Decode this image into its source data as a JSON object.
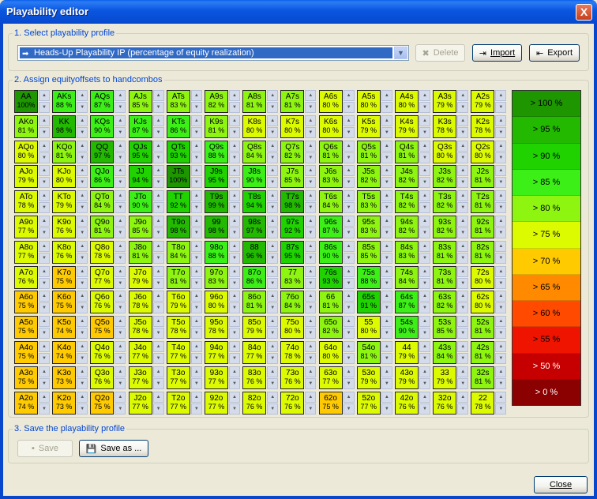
{
  "window": {
    "title": "Playability editor",
    "close_glyph": "X"
  },
  "section1": {
    "label": "1. Select playability profile",
    "profile_value": "Heads-Up Playability IP  (percentage of equity realization)",
    "delete_label": "Delete",
    "import_label": "Import",
    "export_label": "Export"
  },
  "section2": {
    "label": "2. Assign equityoffsets to handcombos"
  },
  "grid": [
    [
      [
        "AA",
        "100%"
      ],
      [
        "AKs",
        "88 %"
      ],
      [
        "AQs",
        "87 %"
      ],
      [
        "AJs",
        "85 %"
      ],
      [
        "ATs",
        "83 %"
      ],
      [
        "A9s",
        "82 %"
      ],
      [
        "A8s",
        "81 %"
      ],
      [
        "A7s",
        "81 %"
      ],
      [
        "A6s",
        "80 %"
      ],
      [
        "A5s",
        "80 %"
      ],
      [
        "A4s",
        "80 %"
      ],
      [
        "A3s",
        "79 %"
      ],
      [
        "A2s",
        "79 %"
      ]
    ],
    [
      [
        "AKo",
        "81 %"
      ],
      [
        "KK",
        "98 %"
      ],
      [
        "KQs",
        "90 %"
      ],
      [
        "KJs",
        "87 %"
      ],
      [
        "KTs",
        "86 %"
      ],
      [
        "K9s",
        "81 %"
      ],
      [
        "K8s",
        "80 %"
      ],
      [
        "K7s",
        "80 %"
      ],
      [
        "K6s",
        "80 %"
      ],
      [
        "K5s",
        "79 %"
      ],
      [
        "K4s",
        "79 %"
      ],
      [
        "K3s",
        "78 %"
      ],
      [
        "K2s",
        "78 %"
      ]
    ],
    [
      [
        "AQo",
        "80 %"
      ],
      [
        "KQo",
        "81 %"
      ],
      [
        "QQ",
        "97 %"
      ],
      [
        "QJs",
        "95 %"
      ],
      [
        "QTs",
        "93 %"
      ],
      [
        "Q9s",
        "88 %"
      ],
      [
        "Q8s",
        "84 %"
      ],
      [
        "Q7s",
        "82 %"
      ],
      [
        "Q6s",
        "81 %"
      ],
      [
        "Q5s",
        "81 %"
      ],
      [
        "Q4s",
        "81 %"
      ],
      [
        "Q3s",
        "80 %"
      ],
      [
        "Q2s",
        "80 %"
      ]
    ],
    [
      [
        "AJo",
        "79 %"
      ],
      [
        "KJo",
        "80 %"
      ],
      [
        "QJo",
        "86 %"
      ],
      [
        "JJ",
        "94 %"
      ],
      [
        "JTs",
        "100%"
      ],
      [
        "J9s",
        "95 %"
      ],
      [
        "J8s",
        "90 %"
      ],
      [
        "J7s",
        "85 %"
      ],
      [
        "J6s",
        "83 %"
      ],
      [
        "J5s",
        "82 %"
      ],
      [
        "J4s",
        "82 %"
      ],
      [
        "J3s",
        "82 %"
      ],
      [
        "J2s",
        "81 %"
      ]
    ],
    [
      [
        "ATo",
        "78 %"
      ],
      [
        "KTo",
        "79 %"
      ],
      [
        "QTo",
        "84 %"
      ],
      [
        "JTo",
        "90 %"
      ],
      [
        "TT",
        "92 %"
      ],
      [
        "T9s",
        "99 %"
      ],
      [
        "T8s",
        "94 %"
      ],
      [
        "T7s",
        "98 %"
      ],
      [
        "T6s",
        "84 %"
      ],
      [
        "T5s",
        "83 %"
      ],
      [
        "T4s",
        "82 %"
      ],
      [
        "T3s",
        "82 %"
      ],
      [
        "T2s",
        "81 %"
      ]
    ],
    [
      [
        "A9o",
        "77 %"
      ],
      [
        "K9o",
        "76 %"
      ],
      [
        "Q9o",
        "81 %"
      ],
      [
        "J9o",
        "85 %"
      ],
      [
        "T9o",
        "98 %"
      ],
      [
        "99",
        "98 %"
      ],
      [
        "98s",
        "97 %"
      ],
      [
        "97s",
        "92 %"
      ],
      [
        "96s",
        "87 %"
      ],
      [
        "95s",
        "83 %"
      ],
      [
        "94s",
        "82 %"
      ],
      [
        "93s",
        "82 %"
      ],
      [
        "92s",
        "81 %"
      ]
    ],
    [
      [
        "A8o",
        "77 %"
      ],
      [
        "K8o",
        "76 %"
      ],
      [
        "Q8o",
        "78 %"
      ],
      [
        "J8o",
        "81 %"
      ],
      [
        "T8o",
        "84 %"
      ],
      [
        "98o",
        "88 %"
      ],
      [
        "88",
        "96 %"
      ],
      [
        "87s",
        "95 %"
      ],
      [
        "86s",
        "90 %"
      ],
      [
        "85s",
        "85 %"
      ],
      [
        "84s",
        "83 %"
      ],
      [
        "83s",
        "81 %"
      ],
      [
        "82s",
        "81 %"
      ]
    ],
    [
      [
        "A7o",
        "76 %"
      ],
      [
        "K7o",
        "75 %"
      ],
      [
        "Q7o",
        "77 %"
      ],
      [
        "J7o",
        "79 %"
      ],
      [
        "T7o",
        "81 %"
      ],
      [
        "97o",
        "83 %"
      ],
      [
        "87o",
        "86 %"
      ],
      [
        "77",
        "83 %"
      ],
      [
        "76s",
        "93 %"
      ],
      [
        "75s",
        "88 %"
      ],
      [
        "74s",
        "84 %"
      ],
      [
        "73s",
        "81 %"
      ],
      [
        "72s",
        "80 %"
      ]
    ],
    [
      [
        "A6o",
        "75 %"
      ],
      [
        "K6o",
        "75 %"
      ],
      [
        "Q6o",
        "76 %"
      ],
      [
        "J6o",
        "78 %"
      ],
      [
        "T6o",
        "79 %"
      ],
      [
        "96o",
        "80 %"
      ],
      [
        "86o",
        "81 %"
      ],
      [
        "76o",
        "84 %"
      ],
      [
        "66",
        "81 %"
      ],
      [
        "65s",
        "91 %"
      ],
      [
        "64s",
        "87 %"
      ],
      [
        "63s",
        "82 %"
      ],
      [
        "62s",
        "80 %"
      ]
    ],
    [
      [
        "A5o",
        "75 %"
      ],
      [
        "K5o",
        "74 %"
      ],
      [
        "Q5o",
        "75 %"
      ],
      [
        "J5o",
        "78 %"
      ],
      [
        "T5o",
        "78 %"
      ],
      [
        "95o",
        "78 %"
      ],
      [
        "85o",
        "79 %"
      ],
      [
        "75o",
        "80 %"
      ],
      [
        "65o",
        "82 %"
      ],
      [
        "55",
        "80 %"
      ],
      [
        "54s",
        "90 %"
      ],
      [
        "53s",
        "85 %"
      ],
      [
        "52s",
        "81 %"
      ]
    ],
    [
      [
        "A4o",
        "75 %"
      ],
      [
        "K4o",
        "74 %"
      ],
      [
        "Q4o",
        "76 %"
      ],
      [
        "J4o",
        "77 %"
      ],
      [
        "T4o",
        "77 %"
      ],
      [
        "94o",
        "77 %"
      ],
      [
        "84o",
        "77 %"
      ],
      [
        "74o",
        "78 %"
      ],
      [
        "64o",
        "80 %"
      ],
      [
        "54o",
        "81 %"
      ],
      [
        "44",
        "79 %"
      ],
      [
        "43s",
        "84 %"
      ],
      [
        "42s",
        "81 %"
      ]
    ],
    [
      [
        "A3o",
        "75 %"
      ],
      [
        "K3o",
        "73 %"
      ],
      [
        "Q3o",
        "76 %"
      ],
      [
        "J3o",
        "77 %"
      ],
      [
        "T3o",
        "77 %"
      ],
      [
        "93o",
        "77 %"
      ],
      [
        "83o",
        "76 %"
      ],
      [
        "73o",
        "76 %"
      ],
      [
        "63o",
        "77 %"
      ],
      [
        "53o",
        "79 %"
      ],
      [
        "43o",
        "79 %"
      ],
      [
        "33",
        "79 %"
      ],
      [
        "32s",
        "81 %"
      ]
    ],
    [
      [
        "A2o",
        "74 %"
      ],
      [
        "K2o",
        "73 %"
      ],
      [
        "Q2o",
        "75 %"
      ],
      [
        "J2o",
        "77 %"
      ],
      [
        "T2o",
        "77 %"
      ],
      [
        "92o",
        "77 %"
      ],
      [
        "82o",
        "76 %"
      ],
      [
        "72o",
        "76 %"
      ],
      [
        "62o",
        "75 %"
      ],
      [
        "52o",
        "77 %"
      ],
      [
        "42o",
        "76 %"
      ],
      [
        "32o",
        "76 %"
      ],
      [
        "22",
        "78 %"
      ]
    ]
  ],
  "legend": [
    {
      "label": "> 100 %",
      "color": "#1d9600",
      "text": "#000000"
    },
    {
      "label": "> 95 %",
      "color": "#22b900",
      "text": "#000000"
    },
    {
      "label": "> 90 %",
      "color": "#1fd200",
      "text": "#000000"
    },
    {
      "label": "> 85 %",
      "color": "#3cef17",
      "text": "#000000"
    },
    {
      "label": "> 80 %",
      "color": "#8ef511",
      "text": "#000000"
    },
    {
      "label": "> 75 %",
      "color": "#ddfb00",
      "text": "#000000"
    },
    {
      "label": "> 70 %",
      "color": "#ffcb00",
      "text": "#000000"
    },
    {
      "label": "> 65 %",
      "color": "#ff8a00",
      "text": "#000000"
    },
    {
      "label": "> 60 %",
      "color": "#ff4a00",
      "text": "#000000"
    },
    {
      "label": "> 55 %",
      "color": "#ef1400",
      "text": "#000000"
    },
    {
      "label": "> 50 %",
      "color": "#c60000",
      "text": "#ffffff"
    },
    {
      "label": "> 0 %",
      "color": "#8b0000",
      "text": "#ffffff"
    }
  ],
  "section3": {
    "label": "3. Save the playability profile",
    "save_label": "Save",
    "save_as_label": "Save as ..."
  },
  "footer": {
    "close_label": "Close"
  }
}
